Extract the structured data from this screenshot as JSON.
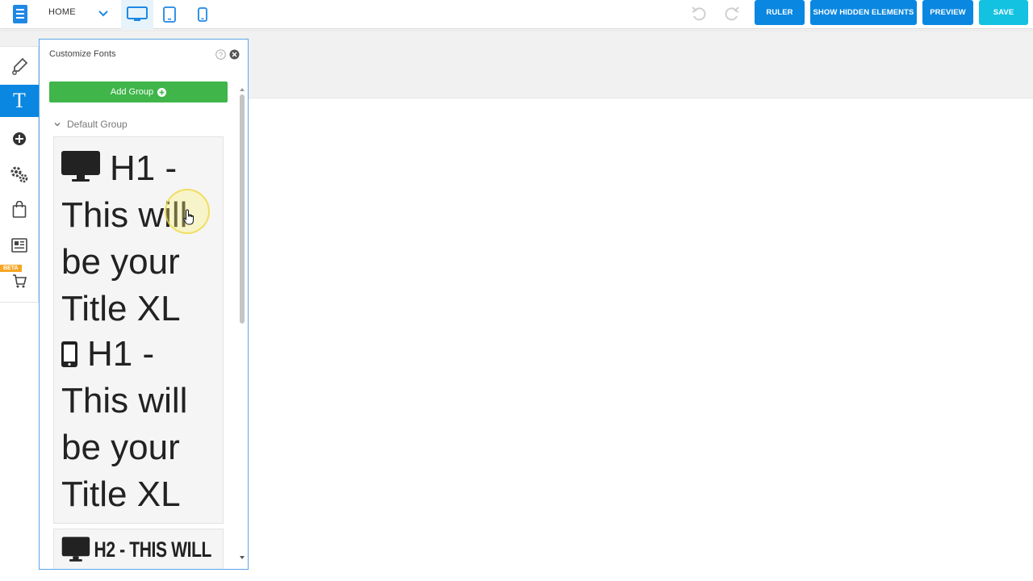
{
  "topbar": {
    "page_name": "HOME",
    "buttons": {
      "ruler": "RULER",
      "show_hidden": "SHOW HIDDEN ELEMENTS",
      "preview": "PREVIEW",
      "save": "SAVE"
    },
    "active_device": "desktop"
  },
  "rail": {
    "items": [
      {
        "name": "paint-icon",
        "active": false
      },
      {
        "name": "text-icon",
        "active": true,
        "label": "T"
      },
      {
        "name": "add-icon",
        "active": false
      },
      {
        "name": "gears-icon",
        "active": false
      },
      {
        "name": "shopping-bag-icon",
        "active": false
      },
      {
        "name": "newspaper-icon",
        "active": false
      },
      {
        "name": "cart-icon",
        "active": false
      }
    ],
    "beta_label": "BETA"
  },
  "panel": {
    "title": "Customize Fonts",
    "add_group_label": "Add Group",
    "group_name": "Default Group",
    "desktop_h1_lines": [
      "H1 -",
      "This will",
      "be your",
      "Title XL"
    ],
    "mobile_h1_lines": [
      "H1 -",
      "This will",
      "be your",
      "Title XL"
    ],
    "h2_preview": "H2 - THIS WILL"
  },
  "colors": {
    "accent": "#0a87e0",
    "save": "#12c2e0",
    "add_group": "#3fb54a",
    "beta": "#f6a623"
  }
}
